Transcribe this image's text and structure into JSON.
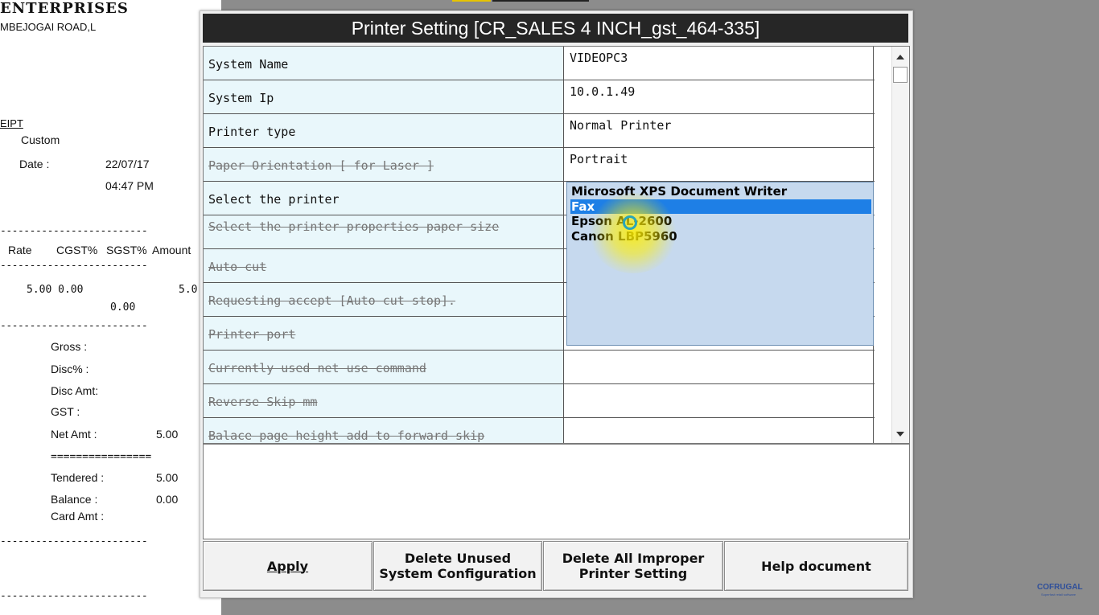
{
  "receipt": {
    "company": "ENTERPRISES",
    "address": "MBEJOGAI ROAD,L",
    "receipt_word": "EIPT",
    "customer": "Custom",
    "date_label": "Date :",
    "date_value": "22/07/17",
    "time_value": "04:47 PM",
    "dashes": "-------------------------",
    "col_rate": "Rate",
    "col_cgst": "CGST%",
    "col_sgst": "SGST%",
    "col_amount": "Amount",
    "item_line": "5.00 0.00",
    "item_amount": "5.0",
    "item_sub": "0.00",
    "gross_label": "Gross   :",
    "disc_pct_label": "Disc%   :",
    "disc_amt_label": "Disc Amt:",
    "gst_label": "GST     :",
    "net_label": "Net Amt :",
    "net_value": "5.00",
    "equals": "================",
    "tendered_label": "Tendered :",
    "tendered_value": "5.00",
    "balance_label": "Balance :",
    "balance_value": "0.00",
    "card_label": "Card Amt :"
  },
  "dialog": {
    "title": "Printer Setting [CR_SALES 4 INCH_gst_464-335]",
    "rows": [
      {
        "label": "System Name",
        "value": "VIDEOPC3",
        "disabled": false
      },
      {
        "label": "System Ip",
        "value": "10.0.1.49",
        "disabled": false
      },
      {
        "label": "Printer type",
        "value": "Normal Printer",
        "disabled": false
      },
      {
        "label": "Paper Orientation [ for Laser ]",
        "value": "Portrait",
        "disabled": true
      },
      {
        "label": "Select the printer",
        "value": "",
        "disabled": false
      },
      {
        "label": "Select the printer properties paper size",
        "value": "",
        "disabled": true
      },
      {
        "label": "Auto cut",
        "value": "",
        "disabled": true
      },
      {
        "label": "Requesting accept [Auto cut stop].",
        "value": "",
        "disabled": true
      },
      {
        "label": "Printer port",
        "value": "",
        "disabled": true
      },
      {
        "label": "Currently used net use command",
        "value": "",
        "disabled": true
      },
      {
        "label": "Reverse Skip mm",
        "value": "",
        "disabled": true
      },
      {
        "label": "Balace page height add to forward skip",
        "value": "",
        "disabled": true
      }
    ],
    "printers": [
      {
        "name": "Microsoft XPS Document Writer",
        "selected": false
      },
      {
        "name": "Fax",
        "selected": true
      },
      {
        "name": "Epson AL-2600",
        "selected": false
      },
      {
        "name": "Canon LBP5960",
        "selected": false
      }
    ],
    "buttons": {
      "apply": "Apply",
      "delete_unused": "Delete Unused\nSystem Configuration",
      "delete_improper": "Delete All Improper\nPrinter Setting",
      "help": "Help document"
    }
  },
  "watermark": {
    "brand": "COFRUGAL",
    "tagline": "Superfast retail software"
  },
  "colors": {
    "title_bg": "#262626",
    "label_bg": "#e9f7fb",
    "list_bg": "#c6d9ee",
    "selection": "#1e7fe6"
  }
}
